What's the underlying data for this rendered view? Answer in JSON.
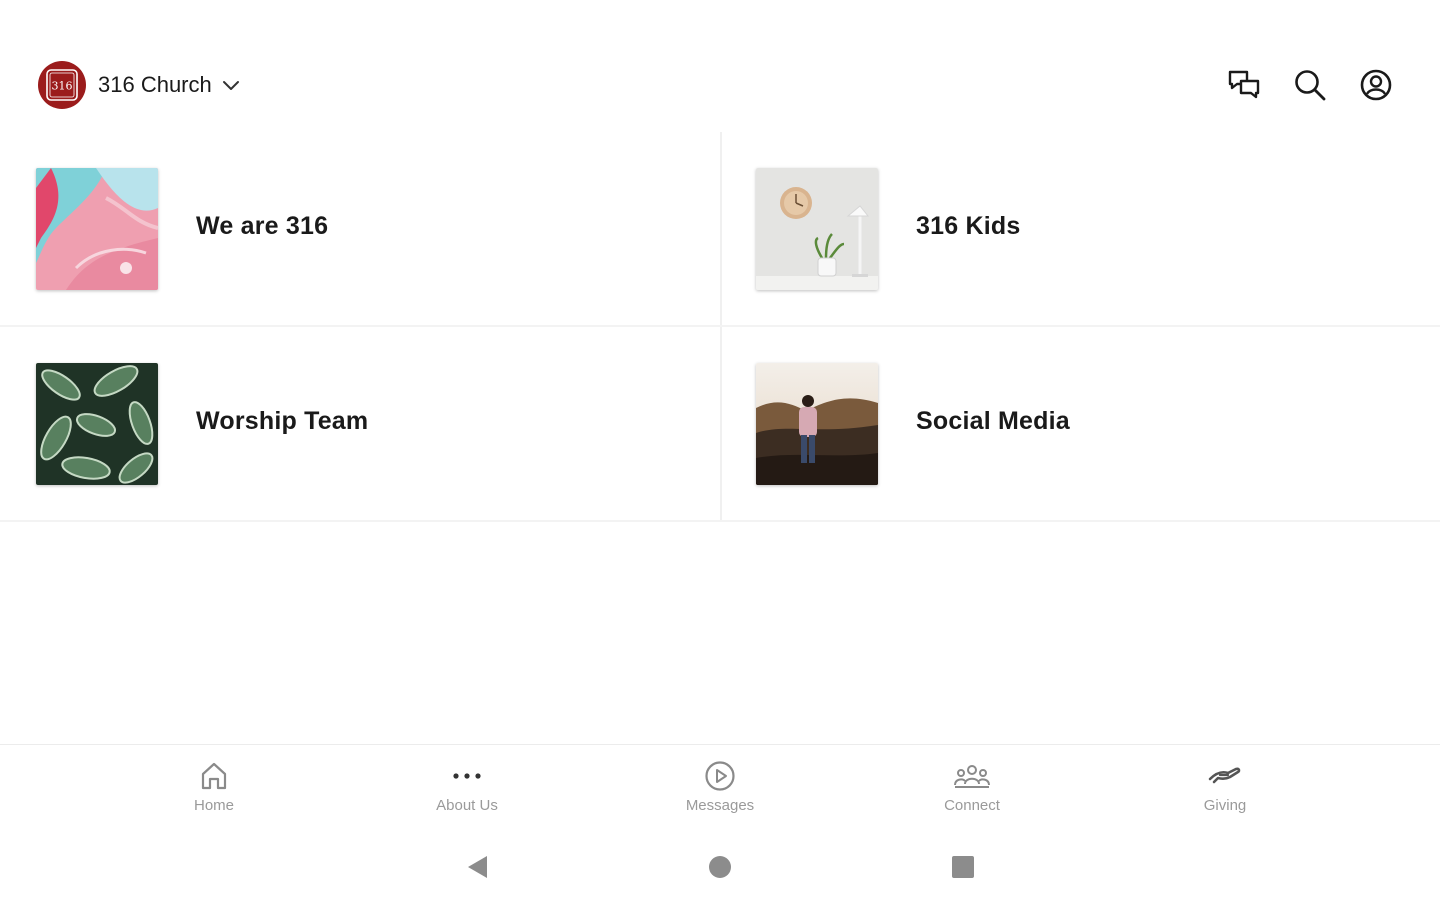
{
  "header": {
    "org_name": "316 Church",
    "logo_text": "316",
    "icons": [
      "chat-icon",
      "search-icon",
      "account-icon"
    ]
  },
  "tiles": [
    {
      "label": "We are 316",
      "thumb": "pink-marble"
    },
    {
      "label": "316 Kids",
      "thumb": "clock-plant-lamp"
    },
    {
      "label": "Worship Team",
      "thumb": "green-leaves"
    },
    {
      "label": "Social Media",
      "thumb": "person-on-hill"
    }
  ],
  "tabs": [
    {
      "label": "Home",
      "icon": "home-icon"
    },
    {
      "label": "About Us",
      "icon": "more-dots-icon"
    },
    {
      "label": "Messages",
      "icon": "play-circle-icon"
    },
    {
      "label": "Connect",
      "icon": "people-icon"
    },
    {
      "label": "Giving",
      "icon": "giving-hand-icon"
    }
  ],
  "colors": {
    "brand": "#9b1c1c",
    "tab_inactive": "#9a9a9a",
    "text": "#1a1a1a",
    "divider": "#f0f0f0"
  }
}
